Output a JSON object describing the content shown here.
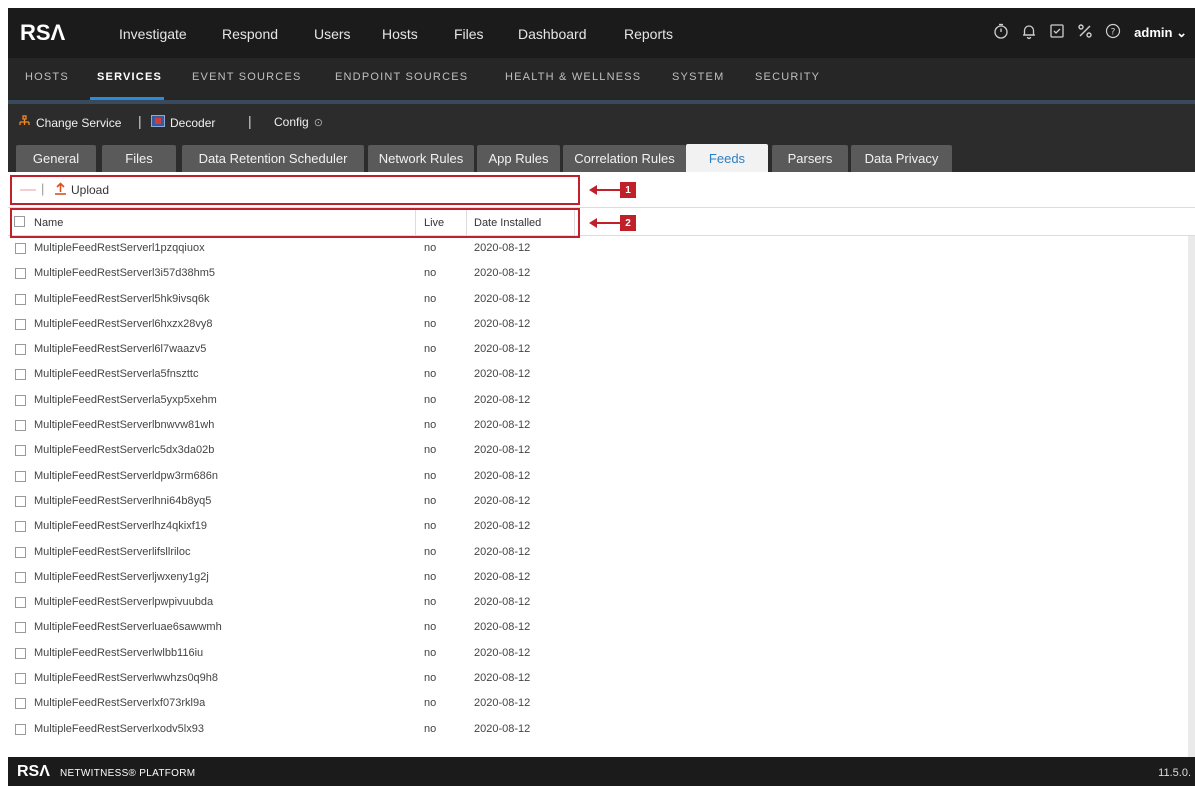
{
  "brand": {
    "logo": "RSΛ"
  },
  "top_nav": {
    "items": [
      "Investigate",
      "Respond",
      "Users",
      "Hosts",
      "Files",
      "Dashboard",
      "Reports"
    ],
    "user": "admin",
    "icons": [
      "stopwatch-icon",
      "bell-icon",
      "clipboard-icon",
      "tools-icon",
      "help-icon"
    ]
  },
  "sub_nav": {
    "items": [
      "HOSTS",
      "SERVICES",
      "EVENT SOURCES",
      "ENDPOINT SOURCES",
      "HEALTH & WELLNESS",
      "SYSTEM",
      "SECURITY"
    ],
    "active": "SERVICES"
  },
  "toolbar": {
    "change_service": "Change Service",
    "decoder": "Decoder",
    "config": "Config"
  },
  "tabs": {
    "items": [
      "General",
      "Files",
      "Data Retention Scheduler",
      "Network Rules",
      "App Rules",
      "Correlation Rules",
      "Feeds",
      "Parsers",
      "Data Privacy"
    ],
    "active": "Feeds"
  },
  "actions": {
    "remove": "—",
    "upload": "Upload"
  },
  "callouts": {
    "one": "1",
    "two": "2"
  },
  "table": {
    "columns": {
      "name": "Name",
      "live": "Live",
      "date": "Date Installed"
    },
    "rows": [
      {
        "name": "MultipleFeedRestServerl1pzqqiuox",
        "live": "no",
        "date": "2020-08-12"
      },
      {
        "name": "MultipleFeedRestServerl3i57d38hm5",
        "live": "no",
        "date": "2020-08-12"
      },
      {
        "name": "MultipleFeedRestServerl5hk9ivsq6k",
        "live": "no",
        "date": "2020-08-12"
      },
      {
        "name": "MultipleFeedRestServerl6hxzx28vy8",
        "live": "no",
        "date": "2020-08-12"
      },
      {
        "name": "MultipleFeedRestServerl6l7waazv5",
        "live": "no",
        "date": "2020-08-12"
      },
      {
        "name": "MultipleFeedRestServerla5fnszttc",
        "live": "no",
        "date": "2020-08-12"
      },
      {
        "name": "MultipleFeedRestServerla5yxp5xehm",
        "live": "no",
        "date": "2020-08-12"
      },
      {
        "name": "MultipleFeedRestServerlbnwvw81wh",
        "live": "no",
        "date": "2020-08-12"
      },
      {
        "name": "MultipleFeedRestServerlc5dx3da02b",
        "live": "no",
        "date": "2020-08-12"
      },
      {
        "name": "MultipleFeedRestServerldpw3rm686n",
        "live": "no",
        "date": "2020-08-12"
      },
      {
        "name": "MultipleFeedRestServerlhni64b8yq5",
        "live": "no",
        "date": "2020-08-12"
      },
      {
        "name": "MultipleFeedRestServerlhz4qkixf19",
        "live": "no",
        "date": "2020-08-12"
      },
      {
        "name": "MultipleFeedRestServerlifsllriloc",
        "live": "no",
        "date": "2020-08-12"
      },
      {
        "name": "MultipleFeedRestServerljwxeny1g2j",
        "live": "no",
        "date": "2020-08-12"
      },
      {
        "name": "MultipleFeedRestServerlpwpivuubda",
        "live": "no",
        "date": "2020-08-12"
      },
      {
        "name": "MultipleFeedRestServerluae6sawwmh",
        "live": "no",
        "date": "2020-08-12"
      },
      {
        "name": "MultipleFeedRestServerlwlbb116iu",
        "live": "no",
        "date": "2020-08-12"
      },
      {
        "name": "MultipleFeedRestServerlwwhzs0q9h8",
        "live": "no",
        "date": "2020-08-12"
      },
      {
        "name": "MultipleFeedRestServerlxf073rkl9a",
        "live": "no",
        "date": "2020-08-12"
      },
      {
        "name": "MultipleFeedRestServerlxodv5lx93",
        "live": "no",
        "date": "2020-08-12"
      }
    ]
  },
  "footer": {
    "brand": "RSΛ",
    "brand_sub": "NETWITNESS® PLATFORM",
    "version": "11.5.0."
  },
  "colors": {
    "accent": "#2a8bd8",
    "callout": "#c0202a",
    "nav_bg": "#1b1b1b",
    "active_tab_text": "#2e7fc2"
  }
}
